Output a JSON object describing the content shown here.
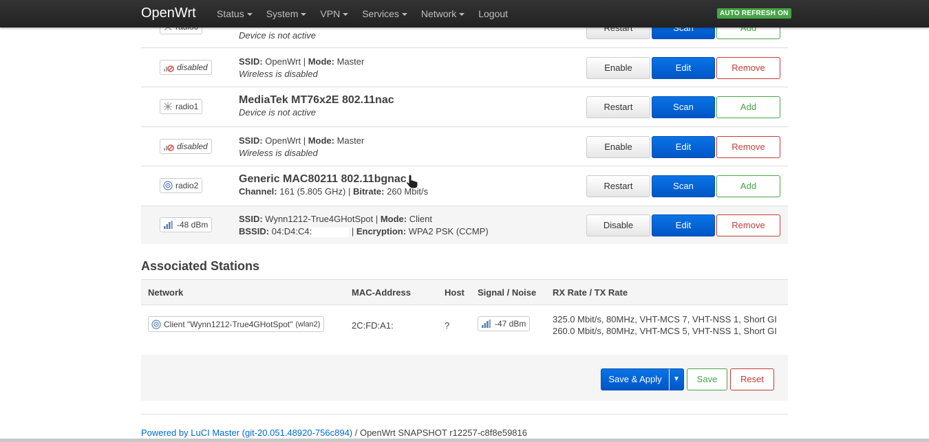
{
  "navbar": {
    "brand": "OpenWrt",
    "menu": [
      "Status",
      "System",
      "VPN",
      "Services",
      "Network",
      "Logout"
    ],
    "auto_refresh": "AUTO REFRESH ON"
  },
  "wireless": {
    "rows": [
      {
        "badge": "radio0",
        "title_suffix": "",
        "line1": "",
        "line2": "Device is not active",
        "buttons": [
          "Restart",
          "Scan",
          "Add"
        ]
      },
      {
        "badge": "disabled",
        "ssid_label": "SSID:",
        "ssid": "OpenWrt",
        "mode_label": "Mode:",
        "mode": "Master",
        "line2": "Wireless is disabled",
        "buttons": [
          "Enable",
          "Edit",
          "Remove"
        ]
      },
      {
        "badge": "radio1",
        "title": "MediaTek MT76x2E 802.11nac",
        "line2": "Device is not active",
        "buttons": [
          "Restart",
          "Scan",
          "Add"
        ]
      },
      {
        "badge": "disabled",
        "ssid_label": "SSID:",
        "ssid": "OpenWrt",
        "mode_label": "Mode:",
        "mode": "Master",
        "line2": "Wireless is disabled",
        "buttons": [
          "Enable",
          "Edit",
          "Remove"
        ]
      },
      {
        "badge": "radio2",
        "title": "Generic MAC80211 802.11bgnac",
        "channel_label": "Channel:",
        "channel": "161 (5.805 GHz)",
        "bitrate_label": "Bitrate:",
        "bitrate": "260 Mbit/s",
        "buttons": [
          "Restart",
          "Scan",
          "Add"
        ]
      },
      {
        "badge": "-48 dBm",
        "ssid_label": "SSID:",
        "ssid": "Wynn1212-True4GHotSpot",
        "mode_label": "Mode:",
        "mode": "Client",
        "bssid_label": "BSSID:",
        "bssid": "04:D4:C4:",
        "enc_label": "Encryption:",
        "enc": "WPA2 PSK (CCMP)",
        "buttons": [
          "Disable",
          "Edit",
          "Remove"
        ]
      }
    ]
  },
  "stations": {
    "title": "Associated Stations",
    "headers": [
      "Network",
      "MAC-Address",
      "Host",
      "Signal / Noise",
      "RX Rate / TX Rate"
    ],
    "row": {
      "network": "Client \"Wynn1212-True4GHotSpot\"",
      "iface": "(wlan2)",
      "mac": "2C:FD:A1:",
      "host": "?",
      "signal": "-47 dBm",
      "rx": "325.0 Mbit/s, 80MHz, VHT-MCS 7, VHT-NSS 1, Short GI",
      "tx": "260.0 Mbit/s, 80MHz, VHT-MCS 5, VHT-NSS 1, Short GI"
    }
  },
  "actions": {
    "save_apply": "Save & Apply",
    "save": "Save",
    "reset": "Reset"
  },
  "footer": {
    "link": "Powered by LuCI Master (git-20.051.48920-756c894)",
    "rest": " / OpenWrt SNAPSHOT r12257-c8f8e59816"
  }
}
